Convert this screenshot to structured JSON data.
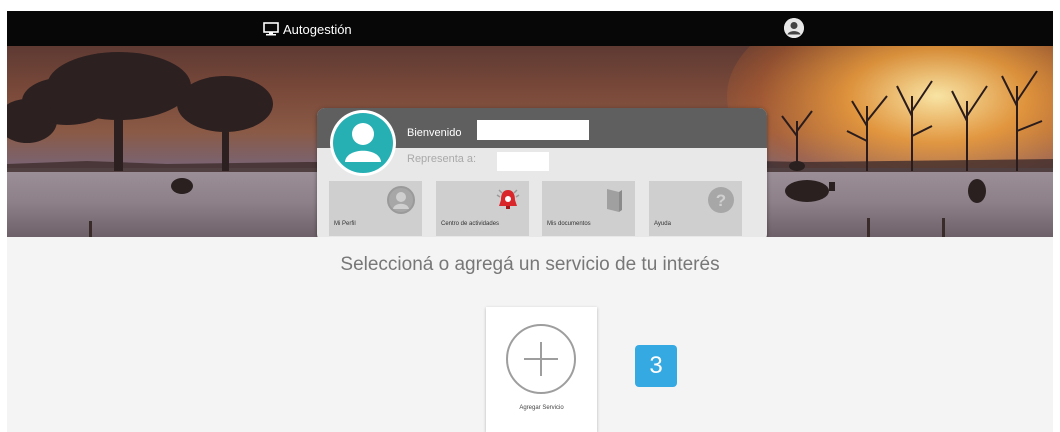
{
  "topbar": {
    "brand_label": "Autogestión",
    "brand_icon": "monitor-icon",
    "user_icon": "user-avatar-icon"
  },
  "welcome_card": {
    "greeting": "Bienvenido",
    "represents_label": "Representa a: ",
    "tiles": [
      {
        "label": "Mi Perfil",
        "icon": "user-circle-icon"
      },
      {
        "label": "Centro de actividades",
        "icon": "alarm-bell-icon"
      },
      {
        "label": "Mis documentos",
        "icon": "book-icon"
      },
      {
        "label": "Ayuda",
        "icon": "help-icon"
      }
    ]
  },
  "main": {
    "heading": "Seleccioná o agregá un servicio de tu interés",
    "add_service_label": "Agregar Servicio"
  },
  "step_badge": "3",
  "colors": {
    "topbar": "#070707",
    "avatar_teal": "#27b0b4",
    "badge_blue": "#35a9e2",
    "heading_gray": "#777777"
  }
}
